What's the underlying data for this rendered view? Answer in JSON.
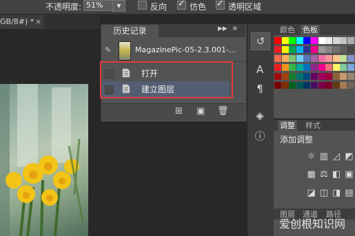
{
  "options_bar": {
    "opacity_label": "不透明度:",
    "opacity_value": "51%",
    "reverse_label": "反向",
    "dither_label": "仿色",
    "transparency_label": "透明区域"
  },
  "document_tab": {
    "title": "GB/8#) *",
    "close": "×"
  },
  "history_panel": {
    "tab_label": "历史记录",
    "snapshot_label": "MagazinePic-05-2.3.001-...",
    "states": [
      {
        "label": "打开",
        "selected": false
      },
      {
        "label": "建立图层",
        "selected": true
      }
    ]
  },
  "right_panels": {
    "swatch_tabs": [
      "颜色",
      "色板"
    ],
    "adjust_tabs": [
      "调整",
      "样式"
    ],
    "adjust_title": "添加调整",
    "layers_tabs": [
      "图层",
      "通道",
      "路径"
    ]
  },
  "watermark": "爱创根知识网",
  "swatch_colors": [
    [
      "#ff0000",
      "#ffff00",
      "#00ff00",
      "#00ffff",
      "#0000ff",
      "#ff00ff",
      "#ffffff",
      "#ebebeb",
      "#d6d6d6",
      "#c2c2c2",
      "#adadad"
    ],
    [
      "#ed1c24",
      "#fff200",
      "#00a651",
      "#00aeef",
      "#2e3192",
      "#ec008c",
      "#999999",
      "#858585",
      "#707070",
      "#5c5c5c",
      "#474747"
    ],
    [
      "#f26c4f",
      "#fbaf5d",
      "#7cc576",
      "#6dcff6",
      "#5674b9",
      "#a864a8",
      "#f06eaa",
      "#f5989d",
      "#fdc68a",
      "#c4df9b",
      "#8393ca"
    ],
    [
      "#ed1c24",
      "#f7941d",
      "#39b54a",
      "#00a99d",
      "#0072bc",
      "#92278f",
      "#ec008c",
      "#f26d7d",
      "#fff568",
      "#82ca9c",
      "#7da7d9"
    ],
    [
      "#9e0b0f",
      "#a0410d",
      "#197b30",
      "#00746b",
      "#004a80",
      "#630460",
      "#9e005d",
      "#9e0039",
      "#8c6239",
      "#c69c6d",
      "#998675"
    ],
    [
      "#790000",
      "#7b2e00",
      "#005e20",
      "#005952",
      "#003663",
      "#440e62",
      "#7b0046",
      "#7a0026",
      "#603913",
      "#a67c52",
      "#736357"
    ]
  ]
}
